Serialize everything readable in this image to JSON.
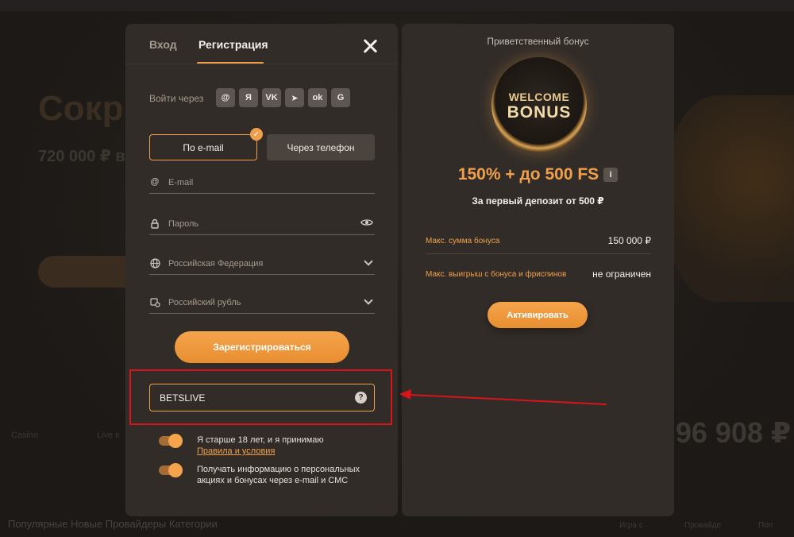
{
  "background": {
    "title": "Сокр",
    "subtitle": "720 000 ₽ в",
    "big_number": "96 908 ₽",
    "left_labels": [
      "Casino",
      "Live к"
    ],
    "nav": "Популярные  Новые  Провайдеры  Категории",
    "right_labels": [
      "Игра с",
      "Провайде",
      "Поп"
    ]
  },
  "tabs": {
    "login": "Вход",
    "register": "Регистрация"
  },
  "social": {
    "label": "Войти через",
    "icons": [
      {
        "name": "mail-icon",
        "glyph": "@"
      },
      {
        "name": "yandex-icon",
        "glyph": "Я"
      },
      {
        "name": "vk-icon",
        "glyph": "VK"
      },
      {
        "name": "telegram-icon",
        "glyph": "➤"
      },
      {
        "name": "odnoklassniki-icon",
        "glyph": "ok"
      },
      {
        "name": "google-icon",
        "glyph": "G"
      }
    ]
  },
  "method": {
    "email": "По e-mail",
    "phone": "Через телефон",
    "check": "✓"
  },
  "form": {
    "email_placeholder": "E-mail",
    "password_placeholder": "Пароль",
    "country": "Российская Федерация",
    "currency": "Российский рубль",
    "submit": "Зарегистрироваться",
    "promo_code": "BETSLIVE",
    "help": "?"
  },
  "consent": {
    "age_text": "Я старше 18 лет, и я принимаю",
    "terms_link": "Правила и условия",
    "marketing_line1": "Получать информацию о персональных",
    "marketing_line2": "акциях и бонусах через e-mail и СМС"
  },
  "bonus": {
    "heading": "Приветственный бонус",
    "badge_line1": "WELCOME",
    "badge_line2": "BONUS",
    "amount": "150% + до 500 FS",
    "info": "i",
    "condition": "За первый депозит от 500 ₽",
    "rows": [
      {
        "label": "Макс. сумма бонуса",
        "value": "150 000 ₽"
      },
      {
        "label": "Макс. выигрыш с бонуса и фриспинов",
        "value": "не ограничен"
      }
    ],
    "activate": "Активировать"
  },
  "colors": {
    "accent": "#f0a04a",
    "highlight": "#d8141b",
    "panel": "#322c28"
  }
}
